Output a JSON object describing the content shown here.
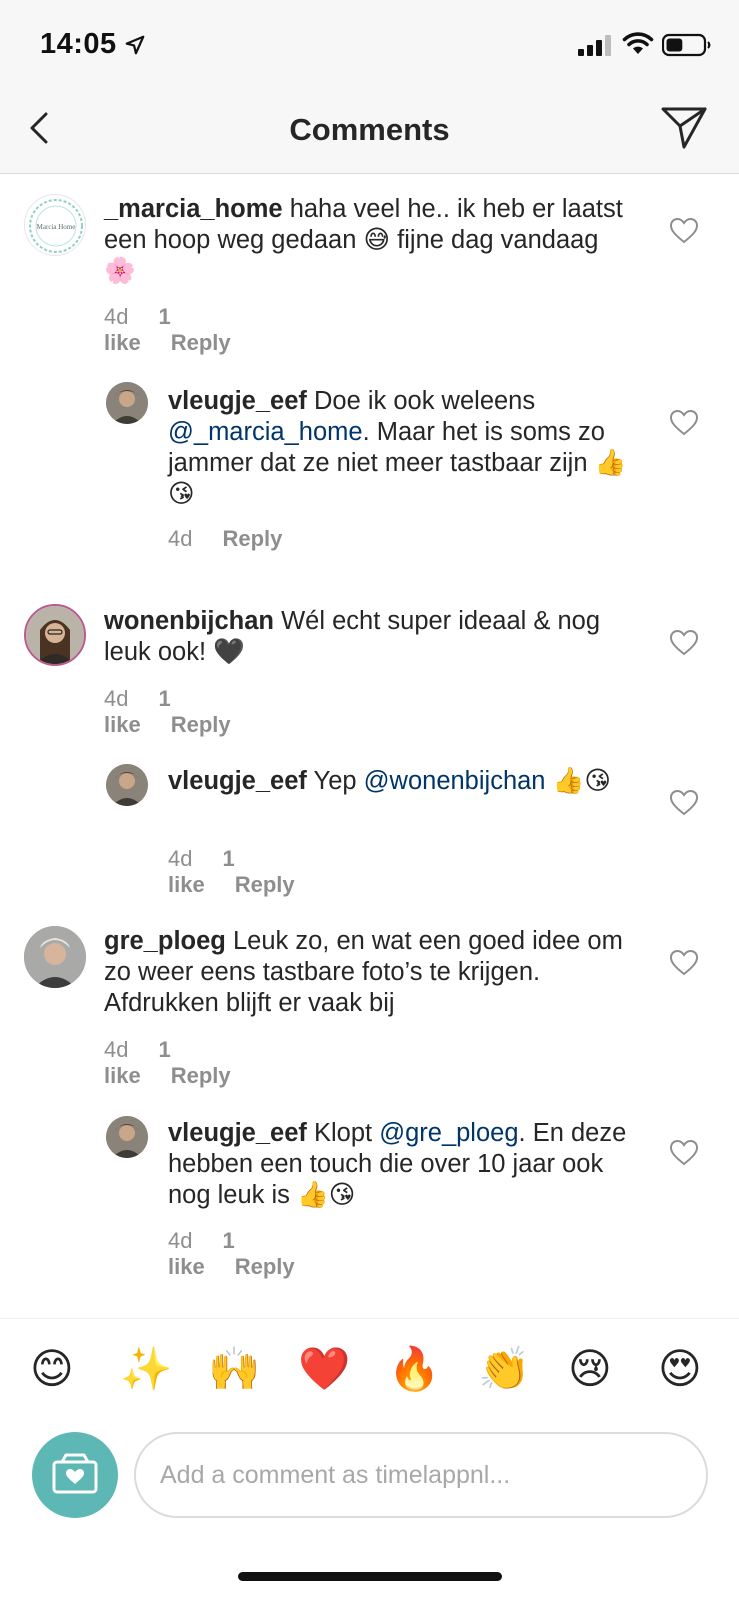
{
  "status_bar": {
    "time": "14:05",
    "battery_level": 0.45
  },
  "nav": {
    "title": "Comments",
    "back_icon": "chevron-left-icon",
    "send_icon": "paper-plane-icon"
  },
  "comments": [
    {
      "username": "_marcia_home",
      "parts": [
        {
          "text": " haha veel he.. ik heb er laatst een hoop weg gedaan 😅 fijne dag vandaag 🌸"
        }
      ],
      "time": "4d",
      "likes": "1 like",
      "reply": "Reply",
      "avatar_text": "Marcia Home"
    },
    {
      "username": "vleugje_eef",
      "parts": [
        {
          "text": " Doe ik ook weleens "
        },
        {
          "mention": "@_marcia_home"
        },
        {
          "text": ". Maar het is soms zo jammer dat ze niet meer tastbaar zijn 👍😘"
        }
      ],
      "time": "4d",
      "likes": "",
      "reply": "Reply"
    },
    {
      "username": "wonenbijchan",
      "parts": [
        {
          "text": " Wél echt super ideaal & nog leuk ook! 🖤"
        }
      ],
      "time": "4d",
      "likes": "1 like",
      "reply": "Reply"
    },
    {
      "username": "vleugje_eef",
      "parts": [
        {
          "text": " Yep "
        },
        {
          "mention": "@wonenbijchan"
        },
        {
          "text": " 👍😘"
        }
      ],
      "time": "4d",
      "likes": "1 like",
      "reply": "Reply"
    },
    {
      "username": "gre_ploeg",
      "parts": [
        {
          "text": " Leuk zo, en wat een goed idee om zo weer eens tastbare foto’s te krijgen. Afdrukken blijft er vaak bij"
        }
      ],
      "time": "4d",
      "likes": "1 like",
      "reply": "Reply"
    },
    {
      "username": "vleugje_eef",
      "parts": [
        {
          "text": " Klopt "
        },
        {
          "mention": "@gre_ploeg"
        },
        {
          "text": ". En deze hebben een touch die over 10 jaar ook nog leuk is 👍😘"
        }
      ],
      "time": "4d",
      "likes": "1 like",
      "reply": "Reply"
    }
  ],
  "emoji_bar": [
    "😊",
    "✨",
    "🙌",
    "❤️",
    "🔥",
    "👏",
    "😢",
    "😍"
  ],
  "composer": {
    "placeholder": "Add a comment as timelappnl...",
    "camera_icon": "camera-icon"
  },
  "colors": {
    "mention": "#003569",
    "meta": "#8e8e8e",
    "camera_button": "#5cb7b5"
  }
}
